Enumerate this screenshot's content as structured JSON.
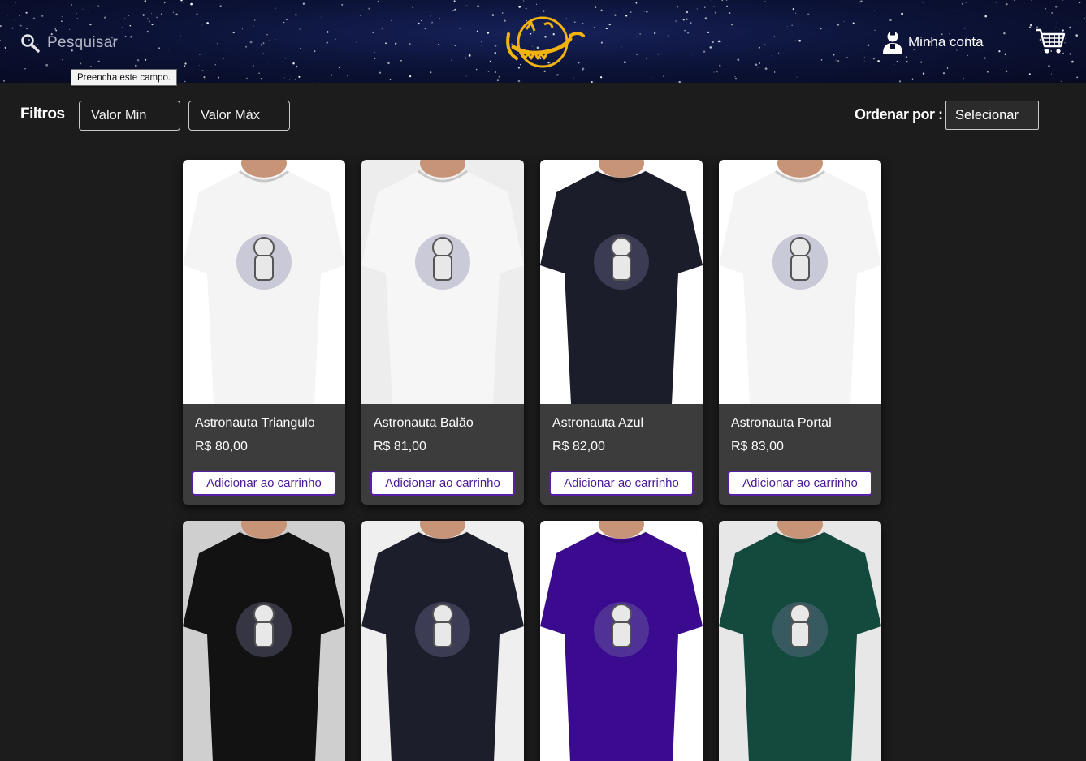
{
  "header": {
    "search": {
      "placeholder": "Pesquisar",
      "tooltip": "Preencha este campo."
    },
    "logo_alt": "Universe",
    "account_label": "Minha conta"
  },
  "filters": {
    "label": "Filtros",
    "min_placeholder": "Valor Min",
    "max_placeholder": "Valor Máx"
  },
  "sort": {
    "label": "Ordenar por :",
    "selected": "Selecionar"
  },
  "products": [
    {
      "name": "Astronauta Triangulo",
      "price": "R$ 80,00",
      "button": "Adicionar ao carrinho",
      "shirt_color": "#f4f4f4",
      "bg": "#ffffff"
    },
    {
      "name": "Astronauta Balão",
      "price": "R$ 81,00",
      "button": "Adicionar ao carrinho",
      "shirt_color": "#f6f6f6",
      "bg": "#ededed"
    },
    {
      "name": "Astronauta Azul",
      "price": "R$ 82,00",
      "button": "Adicionar ao carrinho",
      "shirt_color": "#1b1d2b",
      "bg": "#ffffff"
    },
    {
      "name": "Astronauta Portal",
      "price": "R$ 83,00",
      "button": "Adicionar ao carrinho",
      "shirt_color": "#f4f4f4",
      "bg": "#ffffff"
    },
    {
      "shirt_color": "#121212",
      "bg": "#cfcfcf"
    },
    {
      "shirt_color": "#1c1e2c",
      "bg": "#efefef"
    },
    {
      "shirt_color": "#3b0b8f",
      "bg": "#ffffff"
    },
    {
      "shirt_color": "#144a3e",
      "bg": "#e7e7e7"
    }
  ]
}
